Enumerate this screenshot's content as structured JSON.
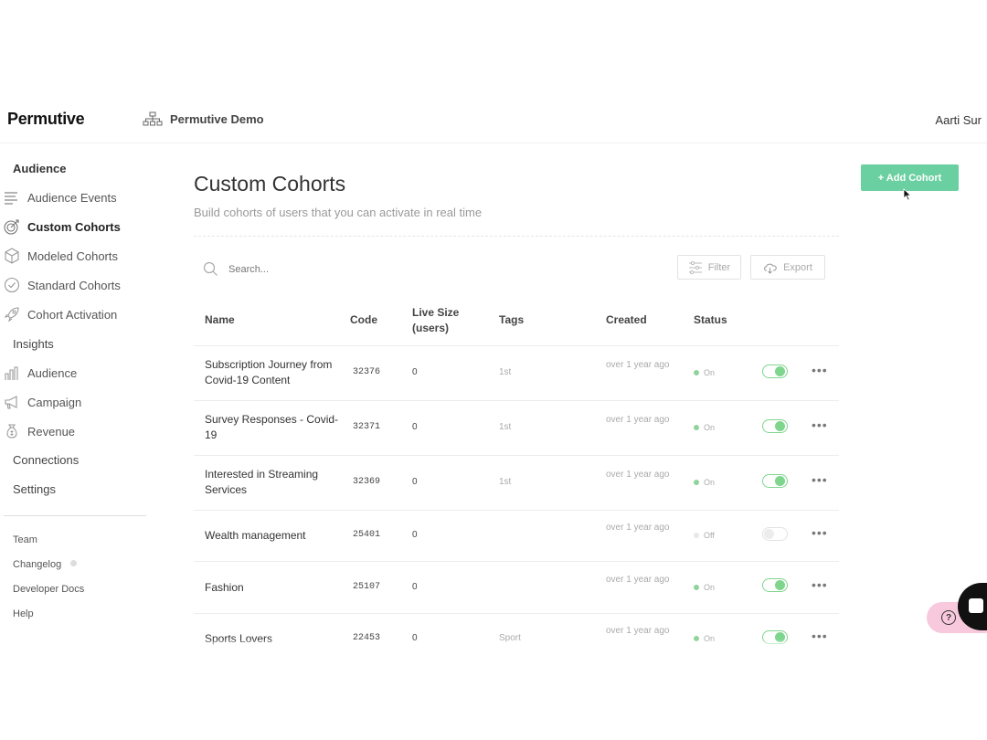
{
  "header": {
    "logo": "Permutive",
    "org_name": "Permutive Demo",
    "user_name": "Aarti Sur"
  },
  "sidebar": {
    "audience_heading": "Audience",
    "audience_items": [
      {
        "label": "Audience Events",
        "icon": "list-icon"
      },
      {
        "label": "Custom Cohorts",
        "icon": "target-icon",
        "active": true
      },
      {
        "label": "Modeled Cohorts",
        "icon": "cube-icon"
      },
      {
        "label": "Standard Cohorts",
        "icon": "badge-check-icon"
      },
      {
        "label": "Cohort Activation",
        "icon": "rocket-icon"
      }
    ],
    "insights_heading": "Insights",
    "insights_items": [
      {
        "label": "Audience",
        "icon": "chart-people-icon"
      },
      {
        "label": "Campaign",
        "icon": "megaphone-icon"
      },
      {
        "label": "Revenue",
        "icon": "money-bag-icon"
      }
    ],
    "connections": "Connections",
    "settings": "Settings",
    "footer_links": [
      "Team",
      "Changelog",
      "Developer Docs",
      "Help"
    ]
  },
  "main": {
    "title": "Custom Cohorts",
    "subtitle": "Build cohorts of users that you can activate in real time",
    "add_button": "+ Add Cohort",
    "search_placeholder": "Search...",
    "filter_label": "Filter",
    "export_label": "Export",
    "columns": {
      "name": "Name",
      "code": "Code",
      "live_size": "Live Size (users)",
      "tags": "Tags",
      "created": "Created",
      "status": "Status"
    },
    "rows": [
      {
        "name": "Subscription Journey from Covid-19 Content",
        "code": "32376",
        "size": "0",
        "tags": "1st",
        "created": "over 1 year ago",
        "status": "On",
        "enabled": true
      },
      {
        "name": "Survey Responses - Covid-19",
        "code": "32371",
        "size": "0",
        "tags": "1st",
        "created": "over 1 year ago",
        "status": "On",
        "enabled": true
      },
      {
        "name": "Interested in Streaming Services",
        "code": "32369",
        "size": "0",
        "tags": "1st",
        "created": "over 1 year ago",
        "status": "On",
        "enabled": true
      },
      {
        "name": "Wealth management",
        "code": "25401",
        "size": "0",
        "tags": "",
        "created": "over 1 year ago",
        "status": "Off",
        "enabled": false
      },
      {
        "name": "Fashion",
        "code": "25107",
        "size": "0",
        "tags": "",
        "created": "over 1 year ago",
        "status": "On",
        "enabled": true
      },
      {
        "name": "Sports Lovers",
        "code": "22453",
        "size": "0",
        "tags": "Sport",
        "created": "over 1 year ago",
        "status": "On",
        "enabled": true
      }
    ]
  },
  "colors": {
    "accent": "#6bd0a1",
    "toggle_on": "#7fd58d",
    "help_bubble": "#f8c9dd"
  }
}
